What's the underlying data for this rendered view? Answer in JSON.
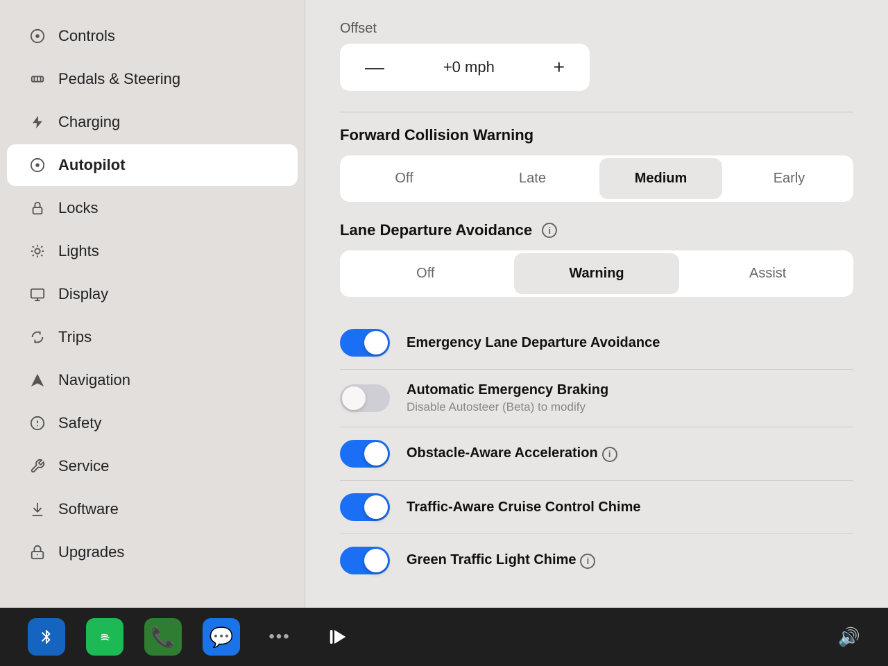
{
  "sidebar": {
    "items": [
      {
        "id": "controls",
        "label": "Controls",
        "icon": "⏸",
        "active": false
      },
      {
        "id": "pedals-steering",
        "label": "Pedals & Steering",
        "icon": "🚗",
        "active": false
      },
      {
        "id": "charging",
        "label": "Charging",
        "icon": "⚡",
        "active": false
      },
      {
        "id": "autopilot",
        "label": "Autopilot",
        "icon": "🎯",
        "active": true
      },
      {
        "id": "locks",
        "label": "Locks",
        "icon": "🔒",
        "active": false
      },
      {
        "id": "lights",
        "label": "Lights",
        "icon": "☀",
        "active": false
      },
      {
        "id": "display",
        "label": "Display",
        "icon": "🖥",
        "active": false
      },
      {
        "id": "trips",
        "label": "Trips",
        "icon": "🔁",
        "active": false
      },
      {
        "id": "navigation",
        "label": "Navigation",
        "icon": "▲",
        "active": false
      },
      {
        "id": "safety",
        "label": "Safety",
        "icon": "⚠",
        "active": false
      },
      {
        "id": "service",
        "label": "Service",
        "icon": "🔧",
        "active": false
      },
      {
        "id": "software",
        "label": "Software",
        "icon": "⬇",
        "active": false
      },
      {
        "id": "upgrades",
        "label": "Upgrades",
        "icon": "🔓",
        "active": false
      }
    ]
  },
  "panel": {
    "offset_label": "Offset",
    "offset_value": "+0 mph",
    "offset_minus": "—",
    "offset_plus": "+",
    "forward_collision": {
      "label": "Forward Collision Warning",
      "options": [
        "Off",
        "Late",
        "Medium",
        "Early"
      ],
      "selected": "Medium"
    },
    "lane_departure": {
      "label": "Lane Departure Avoidance",
      "options": [
        "Off",
        "Warning",
        "Assist"
      ],
      "selected": "Warning"
    },
    "toggles": [
      {
        "id": "emergency-lane",
        "title": "Emergency Lane Departure Avoidance",
        "subtitle": "",
        "state": "on"
      },
      {
        "id": "auto-emergency-braking",
        "title": "Automatic Emergency Braking",
        "subtitle": "Disable Autosteer (Beta) to modify",
        "state": "disabled"
      },
      {
        "id": "obstacle-aware",
        "title": "Obstacle-Aware Acceleration",
        "subtitle": "",
        "state": "on",
        "info": true
      },
      {
        "id": "traffic-cruise",
        "title": "Traffic-Aware Cruise Control Chime",
        "subtitle": "",
        "state": "on"
      },
      {
        "id": "green-light",
        "title": "Green Traffic Light Chime",
        "subtitle": "",
        "state": "on",
        "info": true
      }
    ]
  },
  "taskbar": {
    "items": [
      {
        "id": "bluetooth",
        "label": "bluetooth",
        "icon": "⚡"
      },
      {
        "id": "spotify",
        "label": "spotify",
        "icon": "♪"
      },
      {
        "id": "phone",
        "label": "phone",
        "icon": "📞"
      },
      {
        "id": "messages",
        "label": "messages",
        "icon": "💬"
      },
      {
        "id": "more",
        "label": "more",
        "icon": "..."
      }
    ],
    "volume_icon": "🔊",
    "play_icon": "⏭"
  }
}
